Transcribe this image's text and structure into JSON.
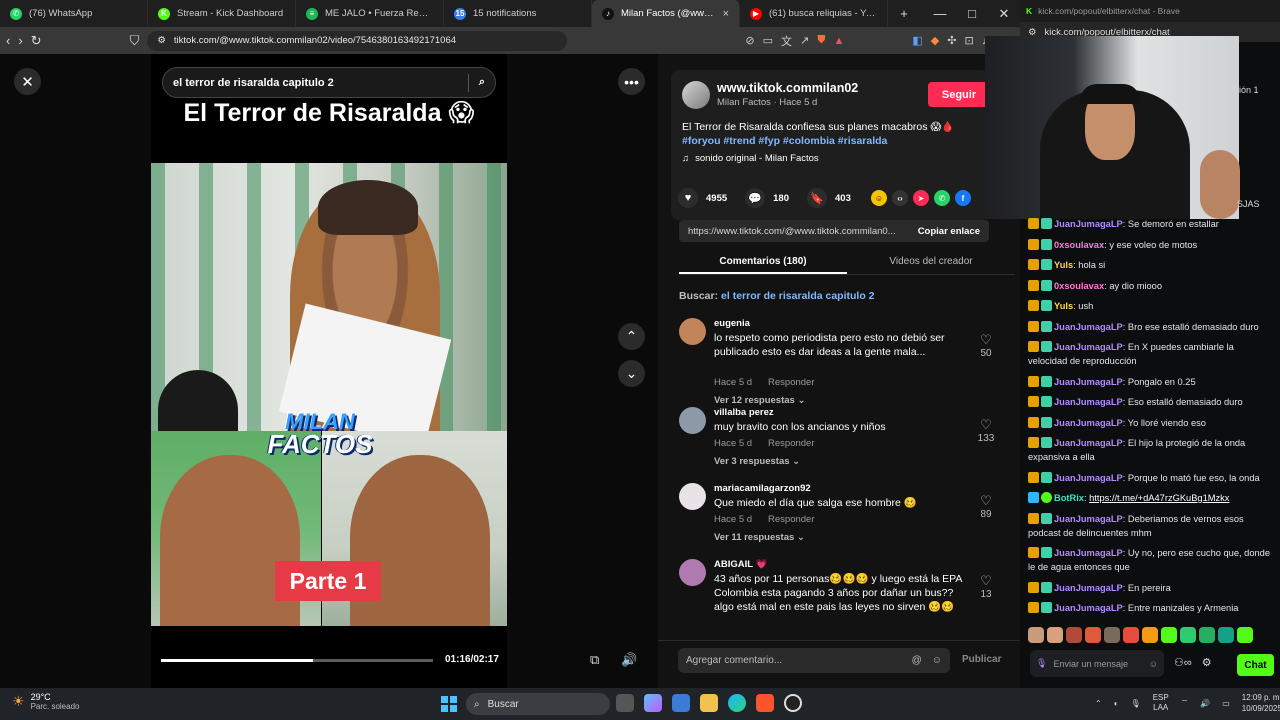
{
  "browser": {
    "tabs": [
      {
        "label": "(76) WhatsApp",
        "icon": "whatsapp-icon",
        "color": "#25d366",
        "glyph": "✆",
        "active": false
      },
      {
        "label": "Stream - Kick Dashboard",
        "icon": "kick-icon",
        "color": "#53fc18",
        "glyph": "K",
        "active": false
      },
      {
        "label": "ME JALO • Fuerza Regida, G",
        "icon": "spotify-icon",
        "color": "#1db954",
        "glyph": "≡",
        "active": false
      },
      {
        "label": "15 notifications",
        "icon": "notifications-icon",
        "color": "#3b7de8",
        "glyph": "15",
        "active": false
      },
      {
        "label": "Milan Factos (@www.tik",
        "icon": "tiktok-icon",
        "color": "#111111",
        "glyph": "♪",
        "active": true
      },
      {
        "label": "(61) busca reliquias - YouTube",
        "icon": "youtube-icon",
        "color": "#ff0000",
        "glyph": "▶",
        "active": false
      }
    ],
    "new_tab": "+",
    "url": "tiktok.com/@www.tiktok.commilan02/video/7546380163492171064"
  },
  "video": {
    "search_query": "el terror de risaralda capitulo 2",
    "title_overlay": "El Terror de Risaralda 😱",
    "logo_line1": "MILAN",
    "logo_line2": "FACTOS",
    "part_label": "Parte 1",
    "time": "01:16/02:17",
    "progress": 0.56
  },
  "author": {
    "name": "www.tiktok.commilan02",
    "sub": "Milan Factos · Hace 5 d",
    "follow": "Seguir",
    "desc_text": "El Terror de Risaralda confiesa sus planes macabros 😱🩸",
    "hashtags": "#foryou #trend #fyp #colombia #risaralda",
    "music": "sonido original - Milan Factos"
  },
  "stats": {
    "likes": "4955",
    "comments": "180",
    "saves": "403"
  },
  "link": {
    "url": "https://www.tiktok.com/@www.tiktok.commilan0...",
    "copy": "Copiar enlace"
  },
  "tabs": {
    "comments": "Comentarios (180)",
    "videos": "Videos del creador"
  },
  "search_related": {
    "label": "Buscar:",
    "query": "el terror de risaralda capitulo 2"
  },
  "comments": [
    {
      "user": "eugenia",
      "text": "lo respeto como periodista pero esto no debió ser publicado esto es dar ideas a la gente mala...",
      "time": "Hace 5 d",
      "reply": "Responder",
      "replies": "Ver 12 respuestas ⌄",
      "likes": "50",
      "avatar": "#c2845a"
    },
    {
      "user": "villalba perez",
      "text": "muy bravito con los ancianos y niños",
      "time": "Hace 5 d",
      "reply": "Responder",
      "replies": "Ver 3 respuestas ⌄",
      "likes": "133",
      "avatar": "#8c9aa8"
    },
    {
      "user": "mariacamilagarzon92",
      "text": "Que miedo el día que salga ese hombre 🥴",
      "time": "Hace 5 d",
      "reply": "Responder",
      "replies": "Ver 11 respuestas ⌄",
      "likes": "89",
      "avatar": "#e9e2e6"
    },
    {
      "user": "ABIGAIL 💗",
      "text": "43 años por 11 personas🥴🥴🥴 y luego está la EPA Colombia esta pagando 3 años por dañar un bus?? algo está mal en este pais las leyes no sirven 🥴🥴",
      "time": "",
      "reply": "",
      "replies": "",
      "likes": "13",
      "avatar": "#b07ab0"
    }
  ],
  "add_comment": {
    "placeholder": "Agregar comentario...",
    "publish": "Publicar"
  },
  "kick": {
    "window_title": "kick.com/popout/elbitterx/chat - Brave",
    "url": "kick.com/popout/elbitterx/chat",
    "overlay_right_top": "ión 1",
    "overlay_right_mid": "SJAS",
    "messages": [
      {
        "user": "JuanJumagaLP",
        "text": "Se demoró en estallar",
        "cls": "",
        "badges": [
          "crown",
          "sub"
        ]
      },
      {
        "user": "0xsoulavax",
        "text": "y ese voleo de motos",
        "cls": "pink",
        "badges": [
          "crown",
          "sub"
        ]
      },
      {
        "user": "Yuls",
        "text": "hola si",
        "cls": "yel",
        "badges": [
          "crown",
          "sub"
        ]
      },
      {
        "user": "0xsoulavax",
        "text": "ay dio miooo",
        "cls": "pink",
        "badges": [
          "crown",
          "sub"
        ]
      },
      {
        "user": "Yuls",
        "text": "ush",
        "cls": "yel",
        "badges": [
          "crown",
          "sub"
        ]
      },
      {
        "user": "JuanJumagaLP",
        "text": "Bro ese estalló demasiado duro",
        "cls": "",
        "badges": [
          "crown",
          "sub"
        ]
      },
      {
        "user": "JuanJumagaLP",
        "text": "En X puedes cambiarle la velocidad de reproducción",
        "cls": "",
        "badges": [
          "crown",
          "sub"
        ]
      },
      {
        "user": "JuanJumagaLP",
        "text": "Pongalo en 0.25",
        "cls": "",
        "badges": [
          "crown",
          "sub"
        ]
      },
      {
        "user": "JuanJumagaLP",
        "text": "Eso estalló demasiado duro",
        "cls": "",
        "badges": [
          "crown",
          "sub"
        ]
      },
      {
        "user": "JuanJumagaLP",
        "text": "Yo lloré viendo eso",
        "cls": "",
        "badges": [
          "crown",
          "sub"
        ]
      },
      {
        "user": "JuanJumagaLP",
        "text": "El hijo la protegió de la onda expansiva a ella",
        "cls": "",
        "badges": [
          "crown",
          "sub"
        ]
      },
      {
        "user": "JuanJumagaLP",
        "text": "Porque lo mató fue eso, la onda",
        "cls": "",
        "badges": [
          "crown",
          "sub"
        ]
      },
      {
        "user": "BotRix",
        "text": "https://t.me/+dA47rzGKuBg1Mzkx",
        "cls": "teal",
        "badges": [
          "bot",
          "ver"
        ],
        "link": true
      },
      {
        "user": "JuanJumagaLP",
        "text": "Deberiamos de vernos esos podcast de delincuentes mhm",
        "cls": "",
        "badges": [
          "crown",
          "sub"
        ]
      },
      {
        "user": "JuanJumagaLP",
        "text": "Uy no, pero ese cucho que, donde le de agua entonces que",
        "cls": "",
        "badges": [
          "crown",
          "sub"
        ]
      },
      {
        "user": "JuanJumagaLP",
        "text": "En pereira",
        "cls": "",
        "badges": [
          "crown",
          "sub"
        ]
      },
      {
        "user": "JuanJumagaLP",
        "text": "Entre manizales y Armenia",
        "cls": "",
        "badges": [
          "crown",
          "sub"
        ]
      }
    ],
    "input_placeholder": "Enviar un mensaje",
    "chat_button": "Chat"
  },
  "taskbar": {
    "temp": "29°C",
    "condition": "Parc. soleado",
    "search": "Buscar",
    "lang1": "ESP",
    "lang2": "LAA",
    "time": "12:09 p. m.",
    "date": "10/09/2025"
  }
}
